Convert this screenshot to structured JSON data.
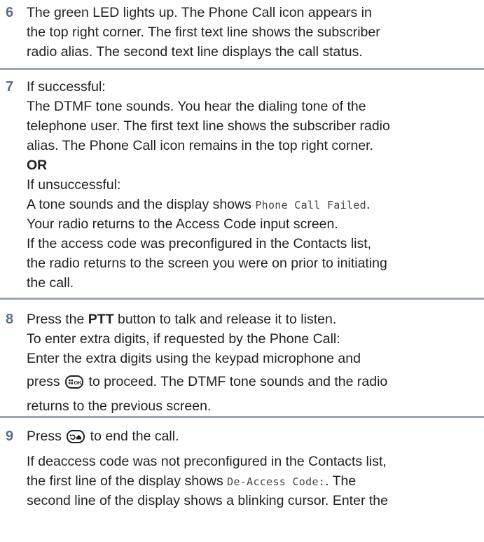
{
  "step6": {
    "number": "6",
    "lines": [
      "The green LED lights up. The Phone Call icon appears in",
      "the top right corner. The first text line shows the subscriber",
      "radio alias. The second text line displays the call status."
    ]
  },
  "step7": {
    "number": "7",
    "line1": "If successful:",
    "line2": "The DTMF tone sounds. You hear the dialing tone of the",
    "line3": "telephone user. The first text line shows the subscriber radio",
    "line4": "alias. The Phone Call icon remains in the top right corner.",
    "or": "OR",
    "line6": "If unsuccessful:",
    "line7_pre": "A tone sounds and the display shows ",
    "line7_mono": "Phone Call Failed",
    "line7_post": ".",
    "line8": "Your radio returns to the Access Code input screen.",
    "line9": "If the access code was preconfigured in the Contacts list,",
    "line10": "the radio returns to the screen you were on prior to initiating",
    "line11": "the call."
  },
  "step8": {
    "number": "8",
    "line1_pre": "Press the ",
    "line1_bold": "PTT",
    "line1_post": " button to talk and release it to listen.",
    "line2": "To enter extra digits, if requested by the Phone Call:",
    "line3": "Enter the extra digits using the keypad microphone and",
    "line4_pre": "press ",
    "line4_key": "menu-ok-key-icon",
    "line4_post": " to proceed. The DTMF tone sounds and the radio",
    "line5": "returns to the previous screen."
  },
  "step9": {
    "number": "9",
    "line1_pre": "Press ",
    "line1_key": "back-home-key-icon",
    "line1_post": " to end the call.",
    "line2": "If deaccess code was not preconfigured in the Contacts list,",
    "line3_pre": "the first line of the display shows ",
    "line3_mono": "De-Access Code:",
    "line3_post": ". The",
    "line4": "second line of the display shows a blinking cursor. Enter the"
  },
  "colors": {
    "step_number": "#5b6f86",
    "rule": "#9aa6b4",
    "text": "#231f20"
  }
}
